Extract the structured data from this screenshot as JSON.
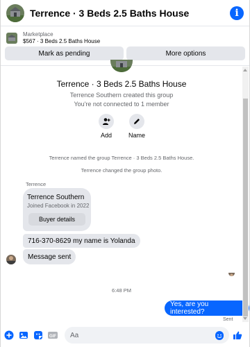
{
  "header": {
    "title": "Terrence · 3 Beds 2.5 Baths House",
    "info_icon": "info-icon"
  },
  "marketplace": {
    "label": "Marketplace",
    "price_title": "$567 · 3 Beds 2.5 Baths House",
    "mark_pending": "Mark as pending",
    "more_options": "More options"
  },
  "group": {
    "title": "Terrence · 3 Beds 2.5 Baths House",
    "created": "Terrence Southern created this group",
    "connection": "You're not connected to 1 member",
    "actions": [
      {
        "label": "Add",
        "icon": "add-person-icon"
      },
      {
        "label": "Name",
        "icon": "pencil-icon"
      }
    ]
  },
  "system_messages": [
    "Terrence named the group Terrence · 3 Beds 2.5 Baths House.",
    "Terrence changed the group photo."
  ],
  "conversation": {
    "sender_label": "Terrence",
    "profile_card": {
      "name": "Terrence Southern",
      "joined": "Joined Facebook in 2022",
      "button": "Buyer details"
    },
    "incoming": [
      "716-370-8629 my name is Yolanda",
      "Message sent"
    ],
    "timestamp": "6:48 PM",
    "outgoing": "Yes, are you interested?",
    "status": "Sent"
  },
  "composer": {
    "placeholder": "Aa"
  },
  "colors": {
    "accent": "#0866ff",
    "bubble_gray": "#e4e6eb",
    "muted_text": "#65676b"
  }
}
